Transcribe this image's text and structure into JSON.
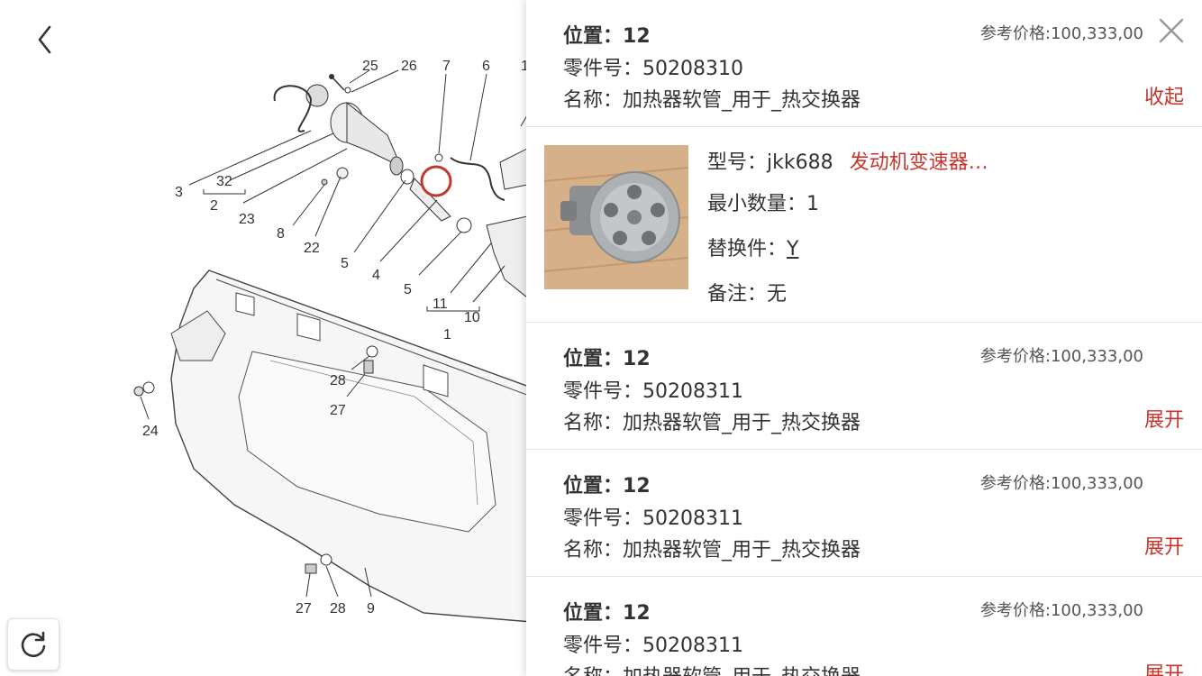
{
  "nav": {
    "back_icon": "chevron-left-icon",
    "refresh_icon": "refresh-icon"
  },
  "diagram": {
    "callouts": [
      "25",
      "26",
      "7",
      "6",
      "1",
      "3",
      "32",
      "2",
      "23",
      "8",
      "22",
      "5",
      "4",
      "5",
      "11",
      "10",
      "1",
      "28",
      "27",
      "24",
      "27",
      "28",
      "9"
    ]
  },
  "panel": {
    "close_icon": "close-icon",
    "parts": [
      {
        "position_label": "位置：",
        "position": "12",
        "part_no_label": "零件号：",
        "part_no": "50208310",
        "name_label": "名称：",
        "name": "加热器软管_用于_热交换器",
        "price": "参考价格:100,333,00",
        "toggle": "收起"
      },
      {
        "position_label": "位置：",
        "position": "12",
        "part_no_label": "零件号：",
        "part_no": "50208311",
        "name_label": "名称：",
        "name": "加热器软管_用于_热交换器",
        "price": "参考价格:100,333,00",
        "toggle": "展开"
      },
      {
        "position_label": "位置：",
        "position": "12",
        "part_no_label": "零件号：",
        "part_no": "50208311",
        "name_label": "名称：",
        "name": "加热器软管_用于_热交换器",
        "price": "参考价格:100,333,00",
        "toggle": "展开"
      },
      {
        "position_label": "位置：",
        "position": "12",
        "part_no_label": "零件号：",
        "part_no": "50208311",
        "name_label": "名称：",
        "name": "加热器软管_用于_热交换器",
        "price": "参考价格:100,333,00",
        "toggle": "展开"
      }
    ],
    "detail": {
      "model_label": "型号：",
      "model": "jkk688",
      "model_extra": "发动机变速器…",
      "min_qty_label": "最小数量：",
      "min_qty": "1",
      "replace_label": "替换件：",
      "replace": "Y",
      "note_label": "备注：",
      "note": "无"
    }
  },
  "colors": {
    "accent": "#c8352b",
    "highlight_circle": "#c0392b"
  }
}
